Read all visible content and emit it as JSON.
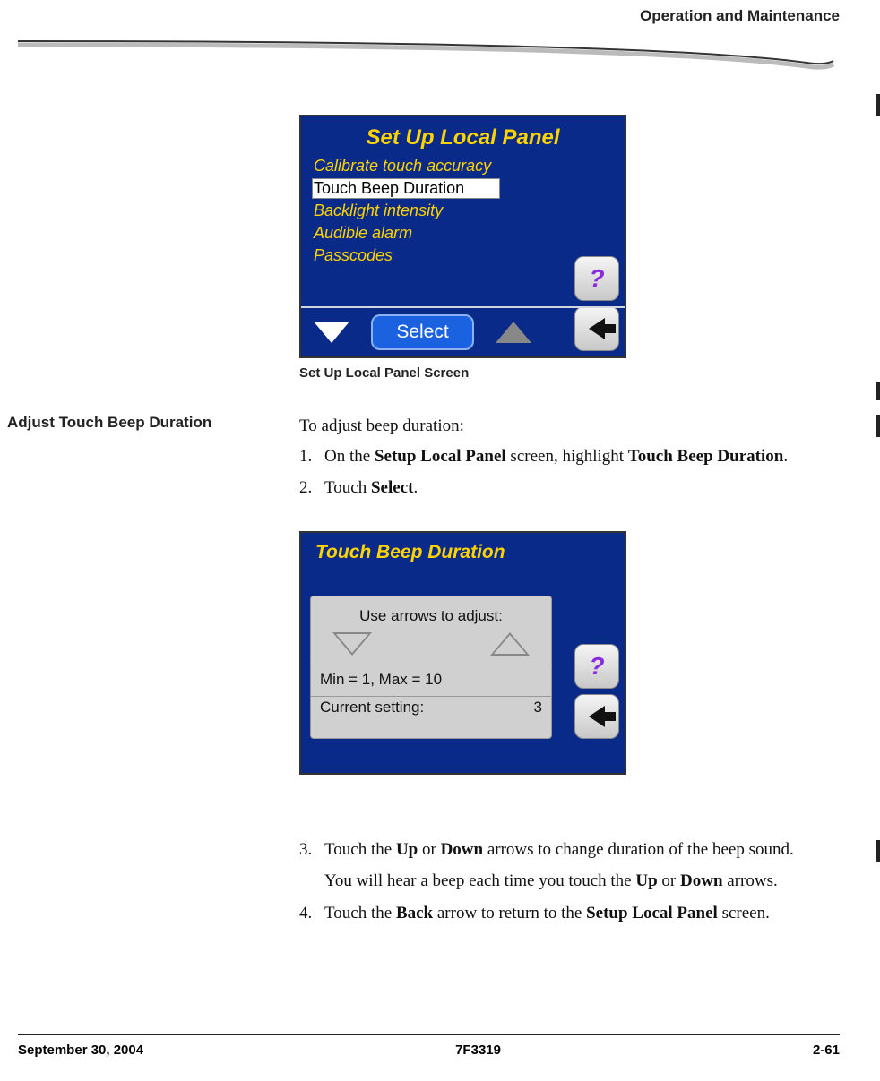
{
  "header": {
    "title": "Operation and Maintenance"
  },
  "fig1": {
    "title": "Set Up Local Panel",
    "items": [
      "Calibrate touch accuracy",
      "Touch Beep Duration",
      "Backlight intensity",
      "Audible alarm",
      "Passcodes"
    ],
    "selected_index": 1,
    "select_label": "Select",
    "help_label": "?",
    "caption": "Set Up Local Panel Screen"
  },
  "section": {
    "side_heading": "Adjust Touch Beep Duration",
    "intro": "To adjust beep duration:",
    "step1_num": "1.",
    "step1_a": "On the ",
    "step1_b": "Setup Local Panel",
    "step1_c": " screen, highlight ",
    "step1_d": "Touch Beep Duration",
    "step1_e": ".",
    "step2_num": "2.",
    "step2_a": "Touch ",
    "step2_b": "Select",
    "step2_c": ".",
    "step3_num": "3.",
    "step3_a": "Touch the ",
    "step3_b": "Up",
    "step3_c": " or ",
    "step3_d": "Down",
    "step3_e": " arrows to change duration of the beep sound.",
    "step3b_a": "You will hear a beep each time you touch the ",
    "step3b_b": "Up",
    "step3b_c": " or ",
    "step3b_d": "Down",
    "step3b_e": " arrows.",
    "step4_num": "4.",
    "step4_a": "Touch the ",
    "step4_b": "Back",
    "step4_c": " arrow to return to the ",
    "step4_d": "Setup Local Panel",
    "step4_e": " screen."
  },
  "fig2": {
    "title": "Touch Beep Duration",
    "use_label": "Use arrows to adjust:",
    "minmax": "Min = 1, Max = 10",
    "current_label": "Current setting:",
    "current_value": "3",
    "help_label": "?"
  },
  "footer": {
    "left": "September 30, 2004",
    "center": "7F3319",
    "right": "2-61"
  }
}
